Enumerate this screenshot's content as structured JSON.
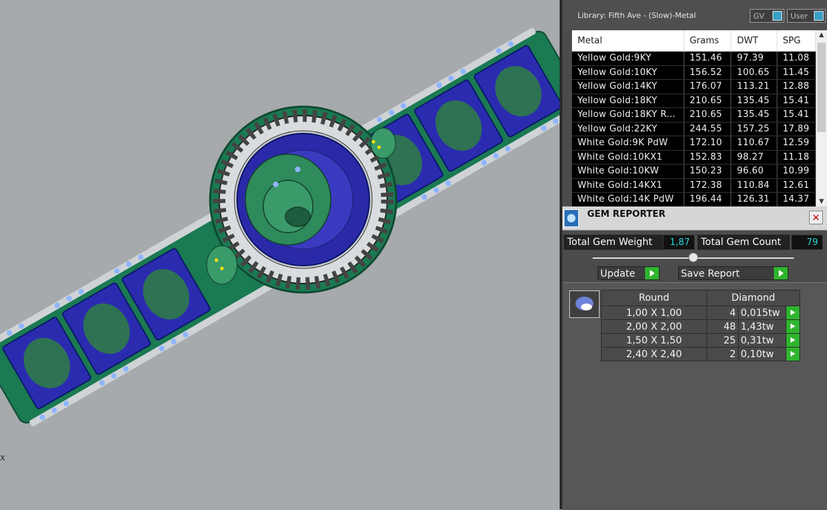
{
  "library": {
    "title": "Library: Fifth Ave - (Slow)-Metal",
    "toggle_gv": "GV",
    "toggle_user": "User",
    "columns": [
      "Metal",
      "Grams",
      "DWT",
      "SPG"
    ],
    "rows": [
      [
        "Yellow Gold:9KY",
        "151.46",
        "97.39",
        "11.08"
      ],
      [
        "Yellow Gold:10KY",
        "156.52",
        "100.65",
        "11.45"
      ],
      [
        "Yellow Gold:14KY",
        "176.07",
        "113.21",
        "12.88"
      ],
      [
        "Yellow Gold:18KY",
        "210.65",
        "135.45",
        "15.41"
      ],
      [
        "Yellow Gold:18KY R...",
        "210.65",
        "135.45",
        "15.41"
      ],
      [
        "Yellow Gold:22KY",
        "244.55",
        "157.25",
        "17.89"
      ],
      [
        "White Gold:9K PdW",
        "172.10",
        "110.67",
        "12.59"
      ],
      [
        "White Gold:10KX1",
        "152.83",
        "98.27",
        "11.18"
      ],
      [
        "White Gold:10KW",
        "150.23",
        "96.60",
        "10.99"
      ],
      [
        "White Gold:14KX1",
        "172.38",
        "110.84",
        "12.61"
      ],
      [
        "White Gold:14K PdW",
        "196.44",
        "126.31",
        "14.37"
      ]
    ]
  },
  "gem_reporter": {
    "title": "GEM REPORTER",
    "total_weight_label": "Total Gem Weight",
    "total_weight_value": "1,87",
    "total_count_label": "Total Gem Count",
    "total_count_value": "79",
    "update_label": "Update",
    "save_label": "Save Report",
    "shape": "Round",
    "material": "Diamond",
    "gems": [
      [
        "1,00 X 1,00",
        "4",
        "0,015tw"
      ],
      [
        "2,00 X 2,00",
        "48",
        "1,43tw"
      ],
      [
        "1,50 X 1,50",
        "25",
        "0,31tw"
      ],
      [
        "2,40 X 2,40",
        "2",
        "0,10tw"
      ]
    ]
  },
  "viewport": {
    "axis_label": "x",
    "colors": {
      "background": "#a7aaac",
      "metal": "#1e8a5c",
      "stone": "#2c2caa",
      "gem": "#8fb5ff"
    }
  }
}
